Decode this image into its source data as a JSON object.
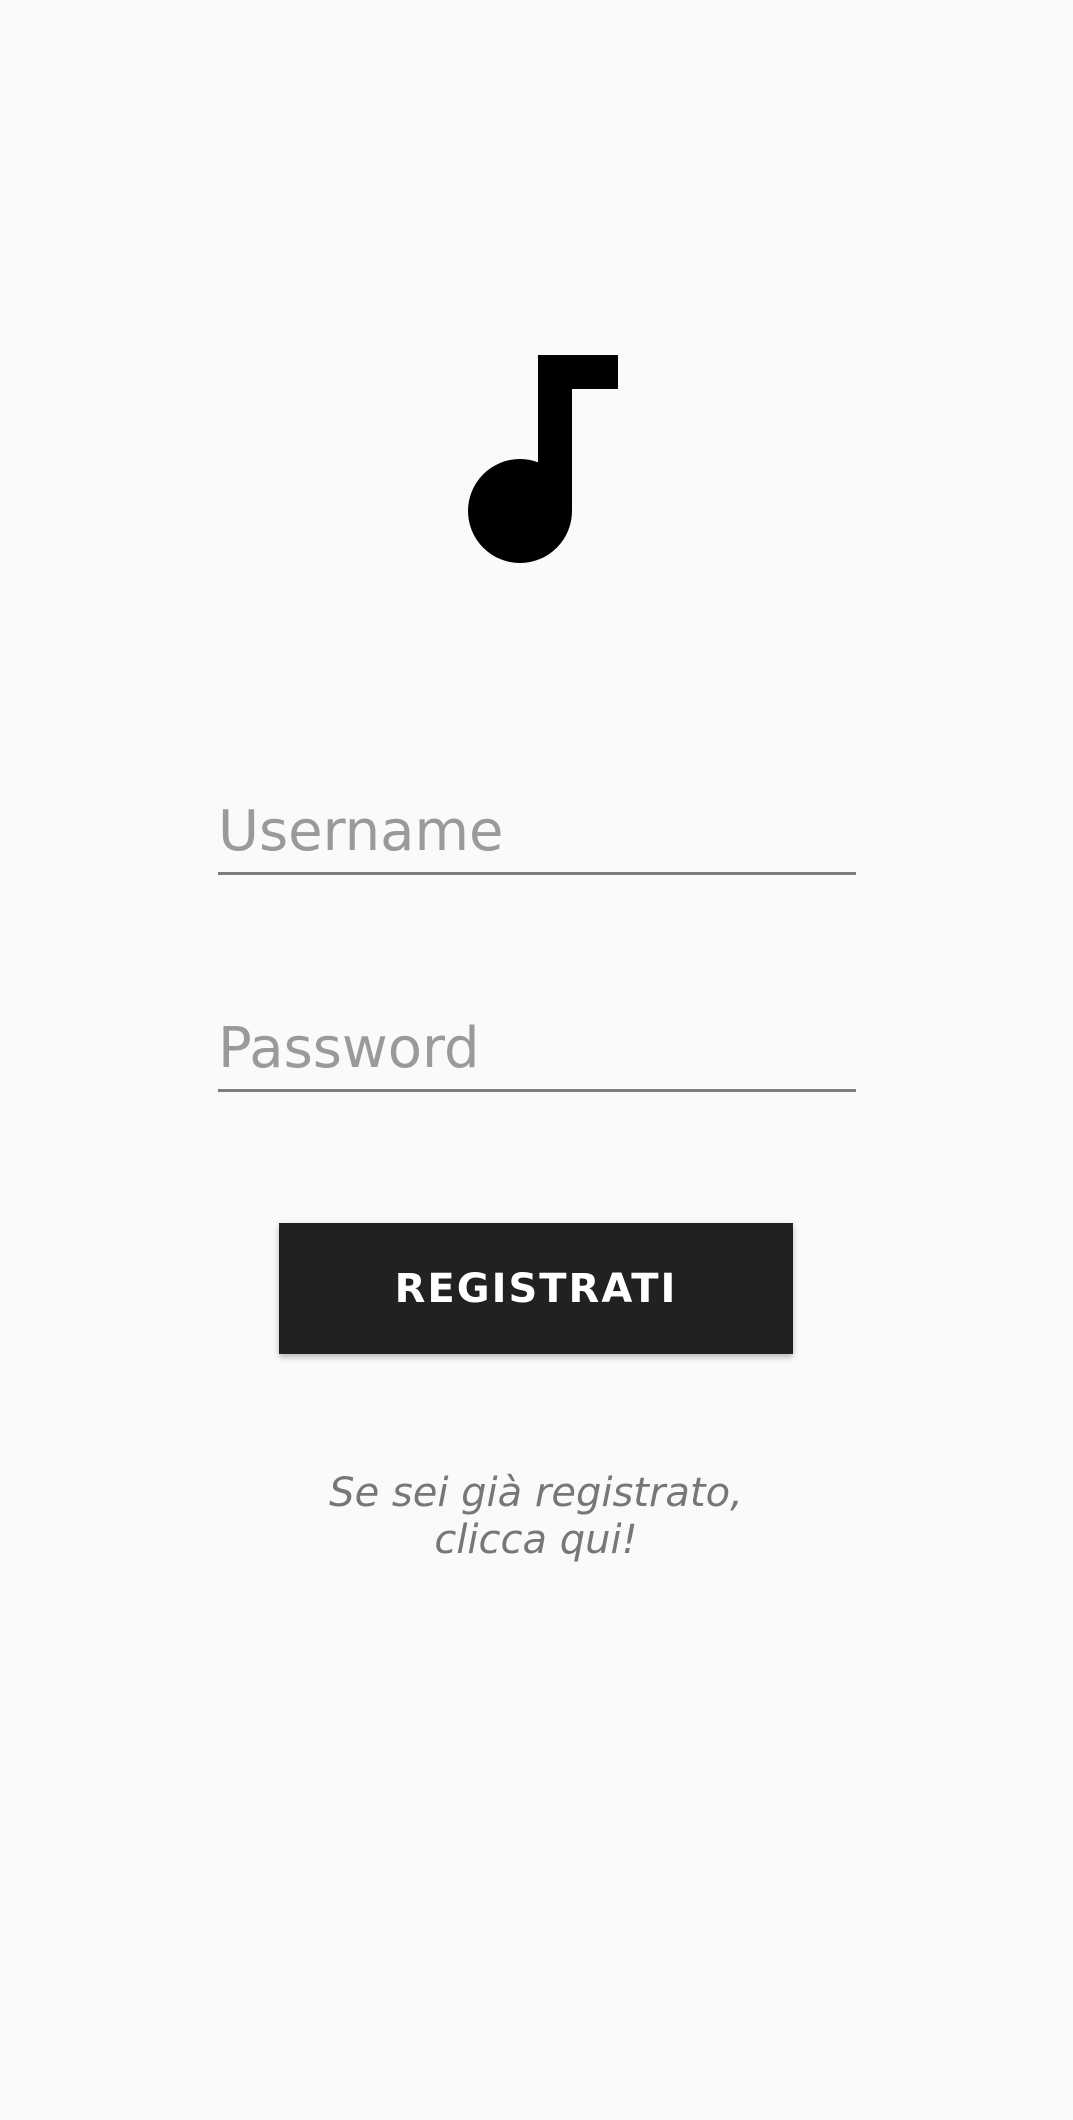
{
  "logo": {
    "icon": "music-note-icon"
  },
  "form": {
    "username_placeholder": "Username",
    "username_value": "",
    "password_placeholder": "Password",
    "password_value": ""
  },
  "register_button": {
    "label": "REGISTRATI"
  },
  "login_link": {
    "line1": "Se sei già registrato,",
    "line2": "clicca qui!"
  },
  "colors": {
    "background": "#fafafa",
    "button": "#212121",
    "button_text": "#ffffff",
    "placeholder": "#9a9a9a",
    "underline": "#7d7d7d",
    "link_text": "#777777"
  }
}
